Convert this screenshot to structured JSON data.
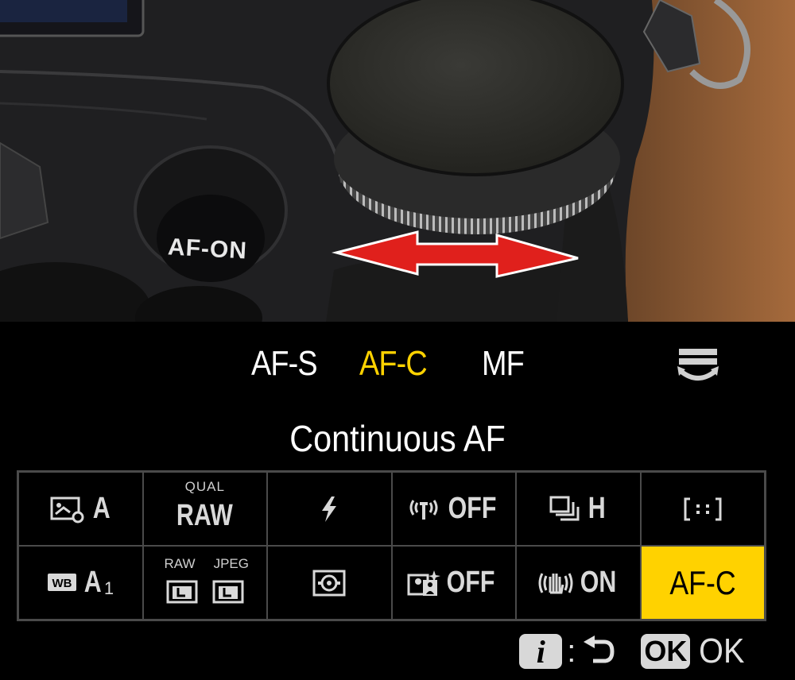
{
  "colors": {
    "accent": "#ffd200",
    "cell_border": "#4a4a4a",
    "arrow": "#e0201c"
  },
  "photo": {
    "button_label": "AF-ON"
  },
  "menu": {
    "modes": [
      {
        "label": "AF-S",
        "active": false
      },
      {
        "label": "AF-C",
        "active": true
      },
      {
        "label": "MF",
        "active": false
      }
    ],
    "title": "Continuous AF",
    "grid": {
      "row1": [
        {
          "icon": "picture-control-icon",
          "text": "A"
        },
        {
          "top": "QUAL",
          "text": "RAW"
        },
        {
          "icon": "flash-icon"
        },
        {
          "icon": "wireless-icon",
          "text": "OFF"
        },
        {
          "icon": "release-mode-icon",
          "text": "H"
        },
        {
          "icon": "af-area-icon"
        }
      ],
      "row2": [
        {
          "icon": "wb-icon",
          "text": "A",
          "sub": "1"
        },
        {
          "left_top": "RAW",
          "right_top": "JPEG",
          "icon": "image-size-icon"
        },
        {
          "icon": "metering-icon"
        },
        {
          "icon": "silent-photo-icon",
          "text": "OFF"
        },
        {
          "icon": "vr-icon",
          "text": "ON"
        },
        {
          "text": "AF-C",
          "selected": true
        }
      ]
    },
    "footer": {
      "i_key": "i",
      "colon": ":",
      "ok_key": "OK",
      "ok_label": "OK"
    }
  }
}
